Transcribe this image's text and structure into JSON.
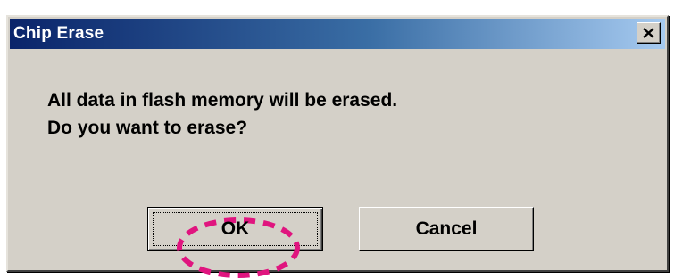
{
  "window": {
    "title": "Chip Erase",
    "close_icon": "close-icon"
  },
  "message": {
    "line1": "All data in flash memory will be erased.",
    "line2": "Do you want to erase?"
  },
  "buttons": {
    "ok_label": "OK",
    "cancel_label": "Cancel",
    "default": "ok"
  },
  "annotation": {
    "shape": "dashed-oval",
    "target": "ok",
    "color": "#e0157f"
  },
  "colors": {
    "title_gradient_start": "#0a246a",
    "title_gradient_end": "#a6caf0",
    "dialog_face": "#d4d0c8"
  }
}
